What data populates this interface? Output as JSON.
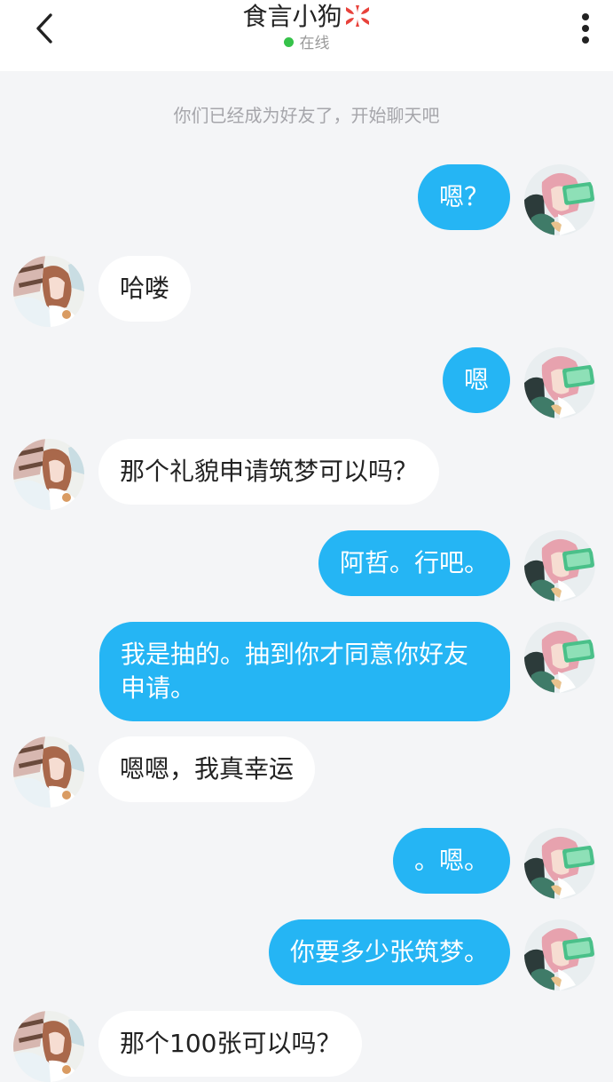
{
  "header": {
    "title": "食言小狗",
    "status": "在线"
  },
  "system_message": "你们已经成为好友了，开始聊天吧",
  "messages": [
    {
      "side": "out",
      "text": "嗯？"
    },
    {
      "side": "in",
      "text": "哈喽"
    },
    {
      "side": "out",
      "text": "嗯"
    },
    {
      "side": "in",
      "text": "那个礼貌申请筑梦可以吗？"
    },
    {
      "side": "out",
      "text": "阿哲。行吧。"
    },
    {
      "side": "out",
      "text": "我是抽的。抽到你才同意你好友申请。"
    },
    {
      "side": "in",
      "text": "嗯嗯，我真幸运"
    },
    {
      "side": "out",
      "text": "。嗯。"
    },
    {
      "side": "out",
      "text": "你要多少张筑梦。"
    },
    {
      "side": "in",
      "text": "那个100张可以吗？"
    }
  ],
  "colors": {
    "accent": "#25b5f4",
    "background": "#f4f5f7",
    "online": "#36c24a"
  }
}
